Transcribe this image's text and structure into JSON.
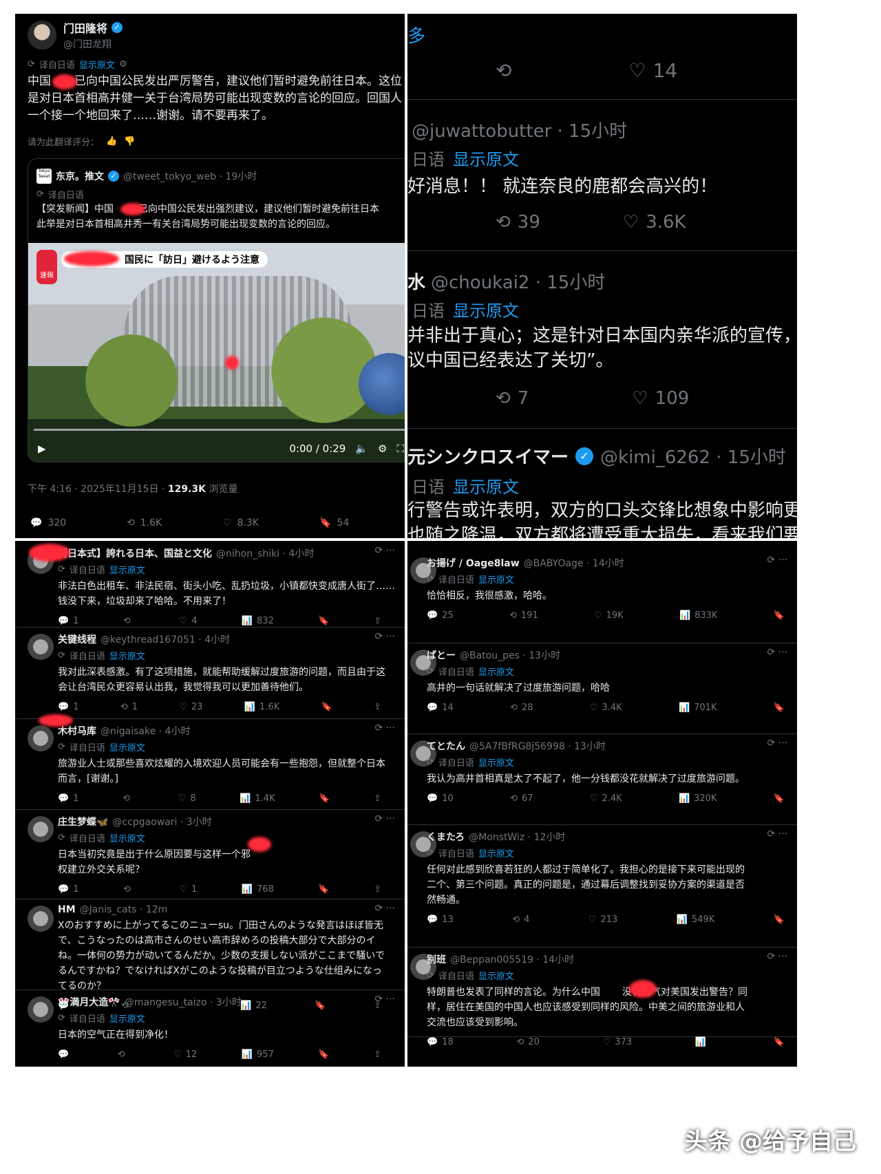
{
  "colors": {
    "bg": "#000000",
    "text": "#e7e9ea",
    "muted": "#71767b",
    "link": "#1d9bf0",
    "redact": "#ff2a3a"
  },
  "main_tweet": {
    "name": "门田隆将",
    "handle": "@门田龙翔",
    "translated_label": "译自日语",
    "show_original": "显示原文",
    "text_lines": [
      "中国",
      "已向中国公民发出严厉警告，建议他们暂时避免前往日本。这位",
      "是对日本首相高井健一关于台湾局势可能出现变数的言论的回应。回国人",
      "一个接一个地回来了……谢谢。请不要再来了。"
    ],
    "rate_prompt": "请为此翻译评分：",
    "quote": {
      "name": "东京。推文",
      "handle": "@tweet_tokyo_web · 19小时",
      "translated_label": "译自日语",
      "line1_a": "【突发新闻】中国",
      "line1_b": "已向中国公民发出强烈建议，建议他们暂时避免前往日本",
      "line2": "此举是对日本首相高井秀一有关台湾局势可能出现变数的言论的回应。",
      "video_banner": "国民に「訪日」避けるよう注意",
      "video_tag": "速報",
      "video_time": "0:00 / 0:29"
    },
    "meta": "下午 4:16 · 2025年11月15日 · ",
    "views": "129.3K",
    "views_label": "浏览量",
    "stats": {
      "replies": "320",
      "reposts": "1.6K",
      "likes": "8.3K",
      "bookmarks": "54"
    }
  },
  "right_top": {
    "top_fragment": "多",
    "row1": {
      "likes": "14"
    },
    "tweets": [
      {
        "handle": "@juwattobutter · 15小时",
        "tr": "日语",
        "show": "显示原文",
        "text": "好消息！！ 就连奈良的鹿都会高兴的！",
        "reposts": "39",
        "likes": "3.6K"
      },
      {
        "name": "水",
        "handle": "@choukai2 · 15小时",
        "tr": "日语",
        "show": "显示原文",
        "text1": "并非出于真心；这是针对日本国内亲华派的宣传，",
        "text2": "议中国已经表达了关切”。",
        "reposts": "7",
        "likes": "109"
      },
      {
        "name": "元シンクロスイマー",
        "handle": "@kimi_6262 · 15小时",
        "tr": "日语",
        "show": "显示原文",
        "text1": "行警告或许表明，双方的口头交锋比想象中影响更",
        "text2": "也随之降温，双方都将遭受重大损失，看来我们要"
      }
    ]
  },
  "left_bottom": [
    {
      "name": "【日本式】誇れる日本、国益と文化",
      "handle": "@nihon_shiki · 4小时",
      "tr": "译自日语",
      "show": "显示原文",
      "text": [
        "非法白色出租车、非法民宿、街头小吃、乱扔垃圾，小镇都快变成唐人街了……",
        "钱没下来，垃圾却来了哈哈。不用来了！"
      ],
      "replies": "1",
      "reposts": "",
      "likes": "4",
      "views": "832"
    },
    {
      "name": "关键线程",
      "handle": "@keythread167051 · 4小时",
      "tr": "译自日语",
      "show": "显示原文",
      "text": [
        "我对此深表感激。有了这项措施，就能帮助缓解过度旅游的问题，而且由于这",
        "会让台湾民众更容易认出我，我觉得我可以更加善待他们。"
      ],
      "replies": "1",
      "reposts": "1",
      "likes": "23",
      "views": "1.6K"
    },
    {
      "name": "木村马库",
      "handle": "@nigaisake · 4小时",
      "tr": "译自日语",
      "show": "显示原文",
      "text": [
        "旅游业人士或那些喜欢炫耀的入境欢迎人员可能会有一些抱怨，但就整个日本",
        "而言，[谢谢。]"
      ],
      "replies": "1",
      "reposts": "",
      "likes": "8",
      "views": "1.4K"
    },
    {
      "name": "庄生梦蝶🦋",
      "handle": "@ccpgaowari · 3小时",
      "tr": "译自日语",
      "show": "显示原文",
      "text": [
        "日本当初究竟是出于什么原因要与这样一个邪",
        "权建立外交关系呢？"
      ],
      "replies": "1",
      "reposts": "",
      "likes": "1",
      "views": "768"
    },
    {
      "name": "HM",
      "handle": "@Janis_cats · 12m",
      "text": [
        "Xのおすすめに上がってるこのニューsu。门田さんのような発言はほぼ皆无",
        "で、こうなったのは高市さんのせい高市辞めろの投稿大部分で大部分のイ",
        "ね。一体何の势力が动いてるんだか。少数の支援しない派がここまで騒いで",
        "るんですかね？でなければXがこのような投稿が目立つような仕组みになっ",
        "てるのか？"
      ],
      "replies": "",
      "reposts": "",
      "likes": "",
      "views": "22"
    },
    {
      "name": "🎌満月大造🎌",
      "handle": "@mangesu_taizo · 3小时",
      "tr": "译自日语",
      "show": "显示原文",
      "text": [
        "日本的空气正在得到净化！"
      ],
      "replies": "",
      "reposts": "",
      "likes": "12",
      "views": "957"
    }
  ],
  "right_bottom": [
    {
      "name": "お揚げ / Oage8law",
      "handle": "@BABYOage · 14小时",
      "tr": "译自日语",
      "show": "显示原文",
      "text": [
        "恰恰相反，我很感激，哈哈。"
      ],
      "replies": "25",
      "reposts": "191",
      "likes": "19K",
      "views": "833K"
    },
    {
      "name": "ばとー",
      "handle": "@Batou_pes · 13小时",
      "tr": "译自日语",
      "show": "显示原文",
      "text": [
        "高井的一句话就解决了过度旅游问题，哈哈"
      ],
      "replies": "14",
      "reposts": "28",
      "likes": "3.4K",
      "views": "701K"
    },
    {
      "name": "てとたん",
      "handle": "@5A7fBfRG8j56998 · 13小时",
      "tr": "译自日语",
      "show": "显示原文",
      "text": [
        "我认为高井首相真是太了不起了，他一分钱都没花就解决了过度旅游问题。"
      ],
      "replies": "10",
      "reposts": "67",
      "likes": "2.4K",
      "views": "320K"
    },
    {
      "name": "くまたろ",
      "handle": "@MonstWiz · 12小时",
      "tr": "译自日语",
      "show": "显示原文",
      "text": [
        "任何对此感到欣喜若狂的人都过于简单化了。我担心的是接下来可能出现的",
        "二个、第三个问题。真正的问题是，通过幕后调整找到妥协方案的渠道是否",
        "然畅通。"
      ],
      "replies": "13",
      "reposts": "4",
      "likes": "213",
      "views": "549K"
    },
    {
      "name": "别班",
      "handle": "@Beppan005519 · 14小时",
      "tr": "译自日语",
      "show": "显示原文",
      "text": [
        "特朗普也发表了同样的言论。为什么中国",
        "没有勇气对美国发出警告？同",
        "样，居住在美国的中国人也应该感受到同样的风险。中美之间的旅游业和人",
        "交流也应该受到影响。"
      ],
      "replies": "18",
      "reposts": "20",
      "likes": "373",
      "views": ""
    }
  ],
  "watermark": "头条 @给予自己"
}
